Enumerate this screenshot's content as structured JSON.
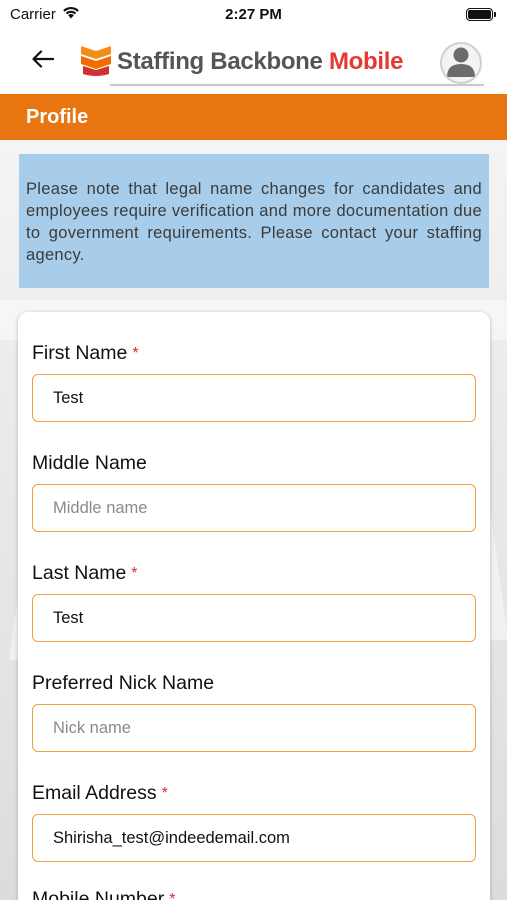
{
  "status_bar": {
    "carrier": "Carrier",
    "time": "2:27 PM"
  },
  "nav": {
    "back_icon": "arrow-left-icon",
    "logo_text_main": "Staffing Backbone ",
    "logo_text_accent": "Mobile",
    "avatar_icon": "user-avatar-icon",
    "accent_color": "#e53935"
  },
  "section": {
    "title": "Profile",
    "color": "#e87510"
  },
  "notice": {
    "text": "Please note that legal name changes for candidates and employees require verification and more documentation due to government requirements. Please contact your staffing agency.",
    "color": "#a7cdea"
  },
  "form": {
    "fields": [
      {
        "label": "First Name",
        "required": "*",
        "value": "Test",
        "placeholder": ""
      },
      {
        "label": "Middle Name",
        "required": "",
        "value": "",
        "placeholder": "Middle name"
      },
      {
        "label": "Last Name",
        "required": "*",
        "value": "Test",
        "placeholder": ""
      },
      {
        "label": "Preferred Nick Name",
        "required": "",
        "value": "",
        "placeholder": "Nick name"
      },
      {
        "label": "Email Address",
        "required": "*",
        "value": "Shirisha_test@indeedemail.com",
        "placeholder": ""
      },
      {
        "label": "Mobile Number",
        "required": "*"
      }
    ]
  }
}
